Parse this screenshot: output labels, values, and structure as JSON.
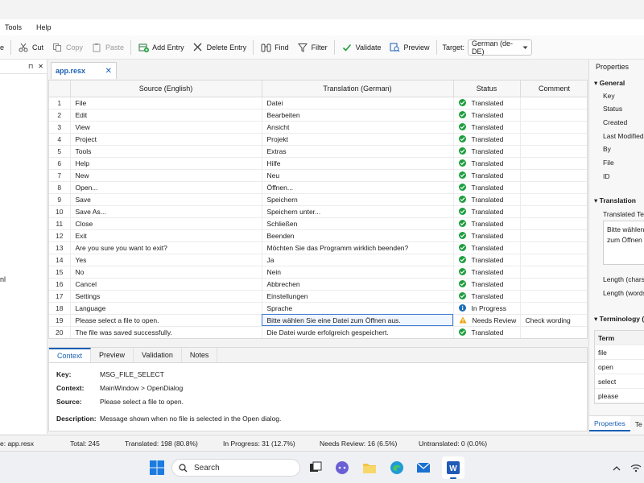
{
  "menu": [
    "Tools",
    "Help"
  ],
  "toolbar": {
    "save_fragment": "e",
    "cut": "Cut",
    "copy": "Copy",
    "paste": "Paste",
    "add_entry": "Add Entry",
    "delete_entry": "Delete Entry",
    "find": "Find",
    "filter": "Filter",
    "validate": "Validate",
    "preview": "Preview",
    "target_label": "Target:",
    "target_value": "German (de-DE)"
  },
  "left_pane": {
    "pin": "⊓",
    "close": "✕",
    "fragment": "nl"
  },
  "doc_tab": {
    "label": "app.resx",
    "close": "✕"
  },
  "grid": {
    "headers": [
      "",
      "Source (English)",
      "Translation (German)",
      "Status",
      "Comment"
    ],
    "rows": [
      {
        "n": "1",
        "src": "File",
        "tr": "Datei",
        "status": "Translated",
        "type": "ok",
        "comment": ""
      },
      {
        "n": "2",
        "src": "Edit",
        "tr": "Bearbeiten",
        "status": "Translated",
        "type": "ok",
        "comment": ""
      },
      {
        "n": "3",
        "src": "View",
        "tr": "Ansicht",
        "status": "Translated",
        "type": "ok",
        "comment": ""
      },
      {
        "n": "4",
        "src": "Project",
        "tr": "Projekt",
        "status": "Translated",
        "type": "ok",
        "comment": ""
      },
      {
        "n": "5",
        "src": "Tools",
        "tr": "Extras",
        "status": "Translated",
        "type": "ok",
        "comment": ""
      },
      {
        "n": "6",
        "src": "Help",
        "tr": "Hilfe",
        "status": "Translated",
        "type": "ok",
        "comment": ""
      },
      {
        "n": "7",
        "src": "New",
        "tr": "Neu",
        "status": "Translated",
        "type": "ok",
        "comment": ""
      },
      {
        "n": "8",
        "src": "Open...",
        "tr": "Öffnen...",
        "status": "Translated",
        "type": "ok",
        "comment": ""
      },
      {
        "n": "9",
        "src": "Save",
        "tr": "Speichern",
        "status": "Translated",
        "type": "ok",
        "comment": ""
      },
      {
        "n": "10",
        "src": "Save As...",
        "tr": "Speichern unter...",
        "status": "Translated",
        "type": "ok",
        "comment": ""
      },
      {
        "n": "11",
        "src": "Close",
        "tr": "Schließen",
        "status": "Translated",
        "type": "ok",
        "comment": ""
      },
      {
        "n": "12",
        "src": "Exit",
        "tr": "Beenden",
        "status": "Translated",
        "type": "ok",
        "comment": ""
      },
      {
        "n": "13",
        "src": "Are you sure you want to exit?",
        "tr": "Möchten Sie das Programm wirklich beenden?",
        "status": "Translated",
        "type": "ok",
        "comment": ""
      },
      {
        "n": "14",
        "src": "Yes",
        "tr": "Ja",
        "status": "Translated",
        "type": "ok",
        "comment": ""
      },
      {
        "n": "15",
        "src": "No",
        "tr": "Nein",
        "status": "Translated",
        "type": "ok",
        "comment": ""
      },
      {
        "n": "16",
        "src": "Cancel",
        "tr": "Abbrechen",
        "status": "Translated",
        "type": "ok",
        "comment": ""
      },
      {
        "n": "17",
        "src": "Settings",
        "tr": "Einstellungen",
        "status": "Translated",
        "type": "ok",
        "comment": ""
      },
      {
        "n": "18",
        "src": "Language",
        "tr": "Sprache",
        "status": "In Progress",
        "type": "info",
        "comment": ""
      },
      {
        "n": "19",
        "src": "Please select a file to open.",
        "tr": "Bitte wählen Sie eine Datei zum Öffnen aus.",
        "status": "Needs Review",
        "type": "warn",
        "comment": "Check wording"
      },
      {
        "n": "20",
        "src": "The file was saved successfully.",
        "tr": "Die Datei wurde erfolgreich gespeichert.",
        "status": "Translated",
        "type": "ok",
        "comment": ""
      }
    ]
  },
  "bottom_tabs": [
    "Context",
    "Preview",
    "Validation",
    "Notes"
  ],
  "context": {
    "key_label": "Key:",
    "key": "MSG_FILE_SELECT",
    "context_label": "Context:",
    "context": "MainWindow > OpenDialog",
    "source_label": "Source:",
    "source": "Please select a file to open.",
    "description_label": "Description:",
    "description": "Message shown when no file is selected in the Open dialog."
  },
  "properties": {
    "title": "Properties",
    "general": "General",
    "general_items": [
      "Key",
      "Status",
      "Created",
      "Last Modified",
      "By",
      "File",
      "ID"
    ],
    "translation": "Translation",
    "translated_text_label": "Translated Tex",
    "translated_text_line1": "Bitte wählen",
    "translated_text_line2": "zum Öffnen",
    "length_chars": "Length (chars)",
    "length_words": "Length (words",
    "terminology": "Terminology (",
    "term_header": "Term",
    "terms": [
      "file",
      "open",
      "select",
      "please"
    ],
    "tabs": [
      "Properties",
      "Te"
    ]
  },
  "status": {
    "file": "e: app.resx",
    "total": "Total: 245",
    "translated": "Translated: 198 (80.8%)",
    "in_progress": "In Progress: 31 (12.7%)",
    "needs_review": "Needs Review: 16 (6.5%)",
    "untranslated": "Untranslated: 0 (0.0%)"
  },
  "taskbar": {
    "search": "Search"
  }
}
